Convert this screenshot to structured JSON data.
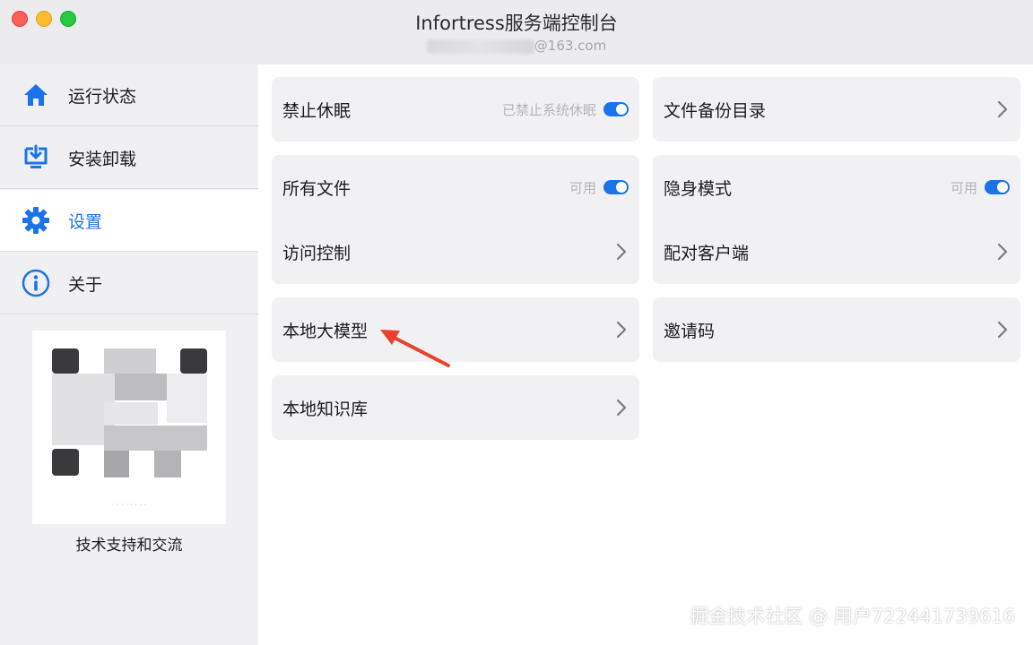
{
  "window": {
    "title": "Infortress服务端控制台",
    "account_visible_suffix": "@163.com"
  },
  "sidebar": {
    "items": [
      {
        "label": "运行状态",
        "icon": "home-icon",
        "active": false
      },
      {
        "label": "安装卸载",
        "icon": "install-icon",
        "active": false
      },
      {
        "label": "设置",
        "icon": "gear-icon",
        "active": true
      },
      {
        "label": "关于",
        "icon": "info-icon",
        "active": false
      }
    ],
    "support_label": "技术支持和交流"
  },
  "settings": {
    "left": [
      {
        "label": "禁止休眠",
        "hint": "已禁止系统休眠",
        "control": "toggle",
        "on": true
      },
      {
        "label": "所有文件",
        "hint": "可用",
        "control": "toggle",
        "on": true
      },
      {
        "label": "访问控制",
        "control": "chevron"
      },
      {
        "label": "本地大模型",
        "control": "chevron"
      },
      {
        "label": "本地知识库",
        "control": "chevron"
      }
    ],
    "right": [
      {
        "label": "文件备份目录",
        "control": "chevron"
      },
      {
        "label": "隐身模式",
        "hint": "可用",
        "control": "toggle",
        "on": true
      },
      {
        "label": "配对客户端",
        "control": "chevron"
      },
      {
        "label": "邀请码",
        "control": "chevron"
      }
    ]
  },
  "watermark": "掘金技术社区 @ 用户722441739616",
  "colors": {
    "accent": "#1a73e8",
    "annotation_arrow": "#e8412c"
  }
}
